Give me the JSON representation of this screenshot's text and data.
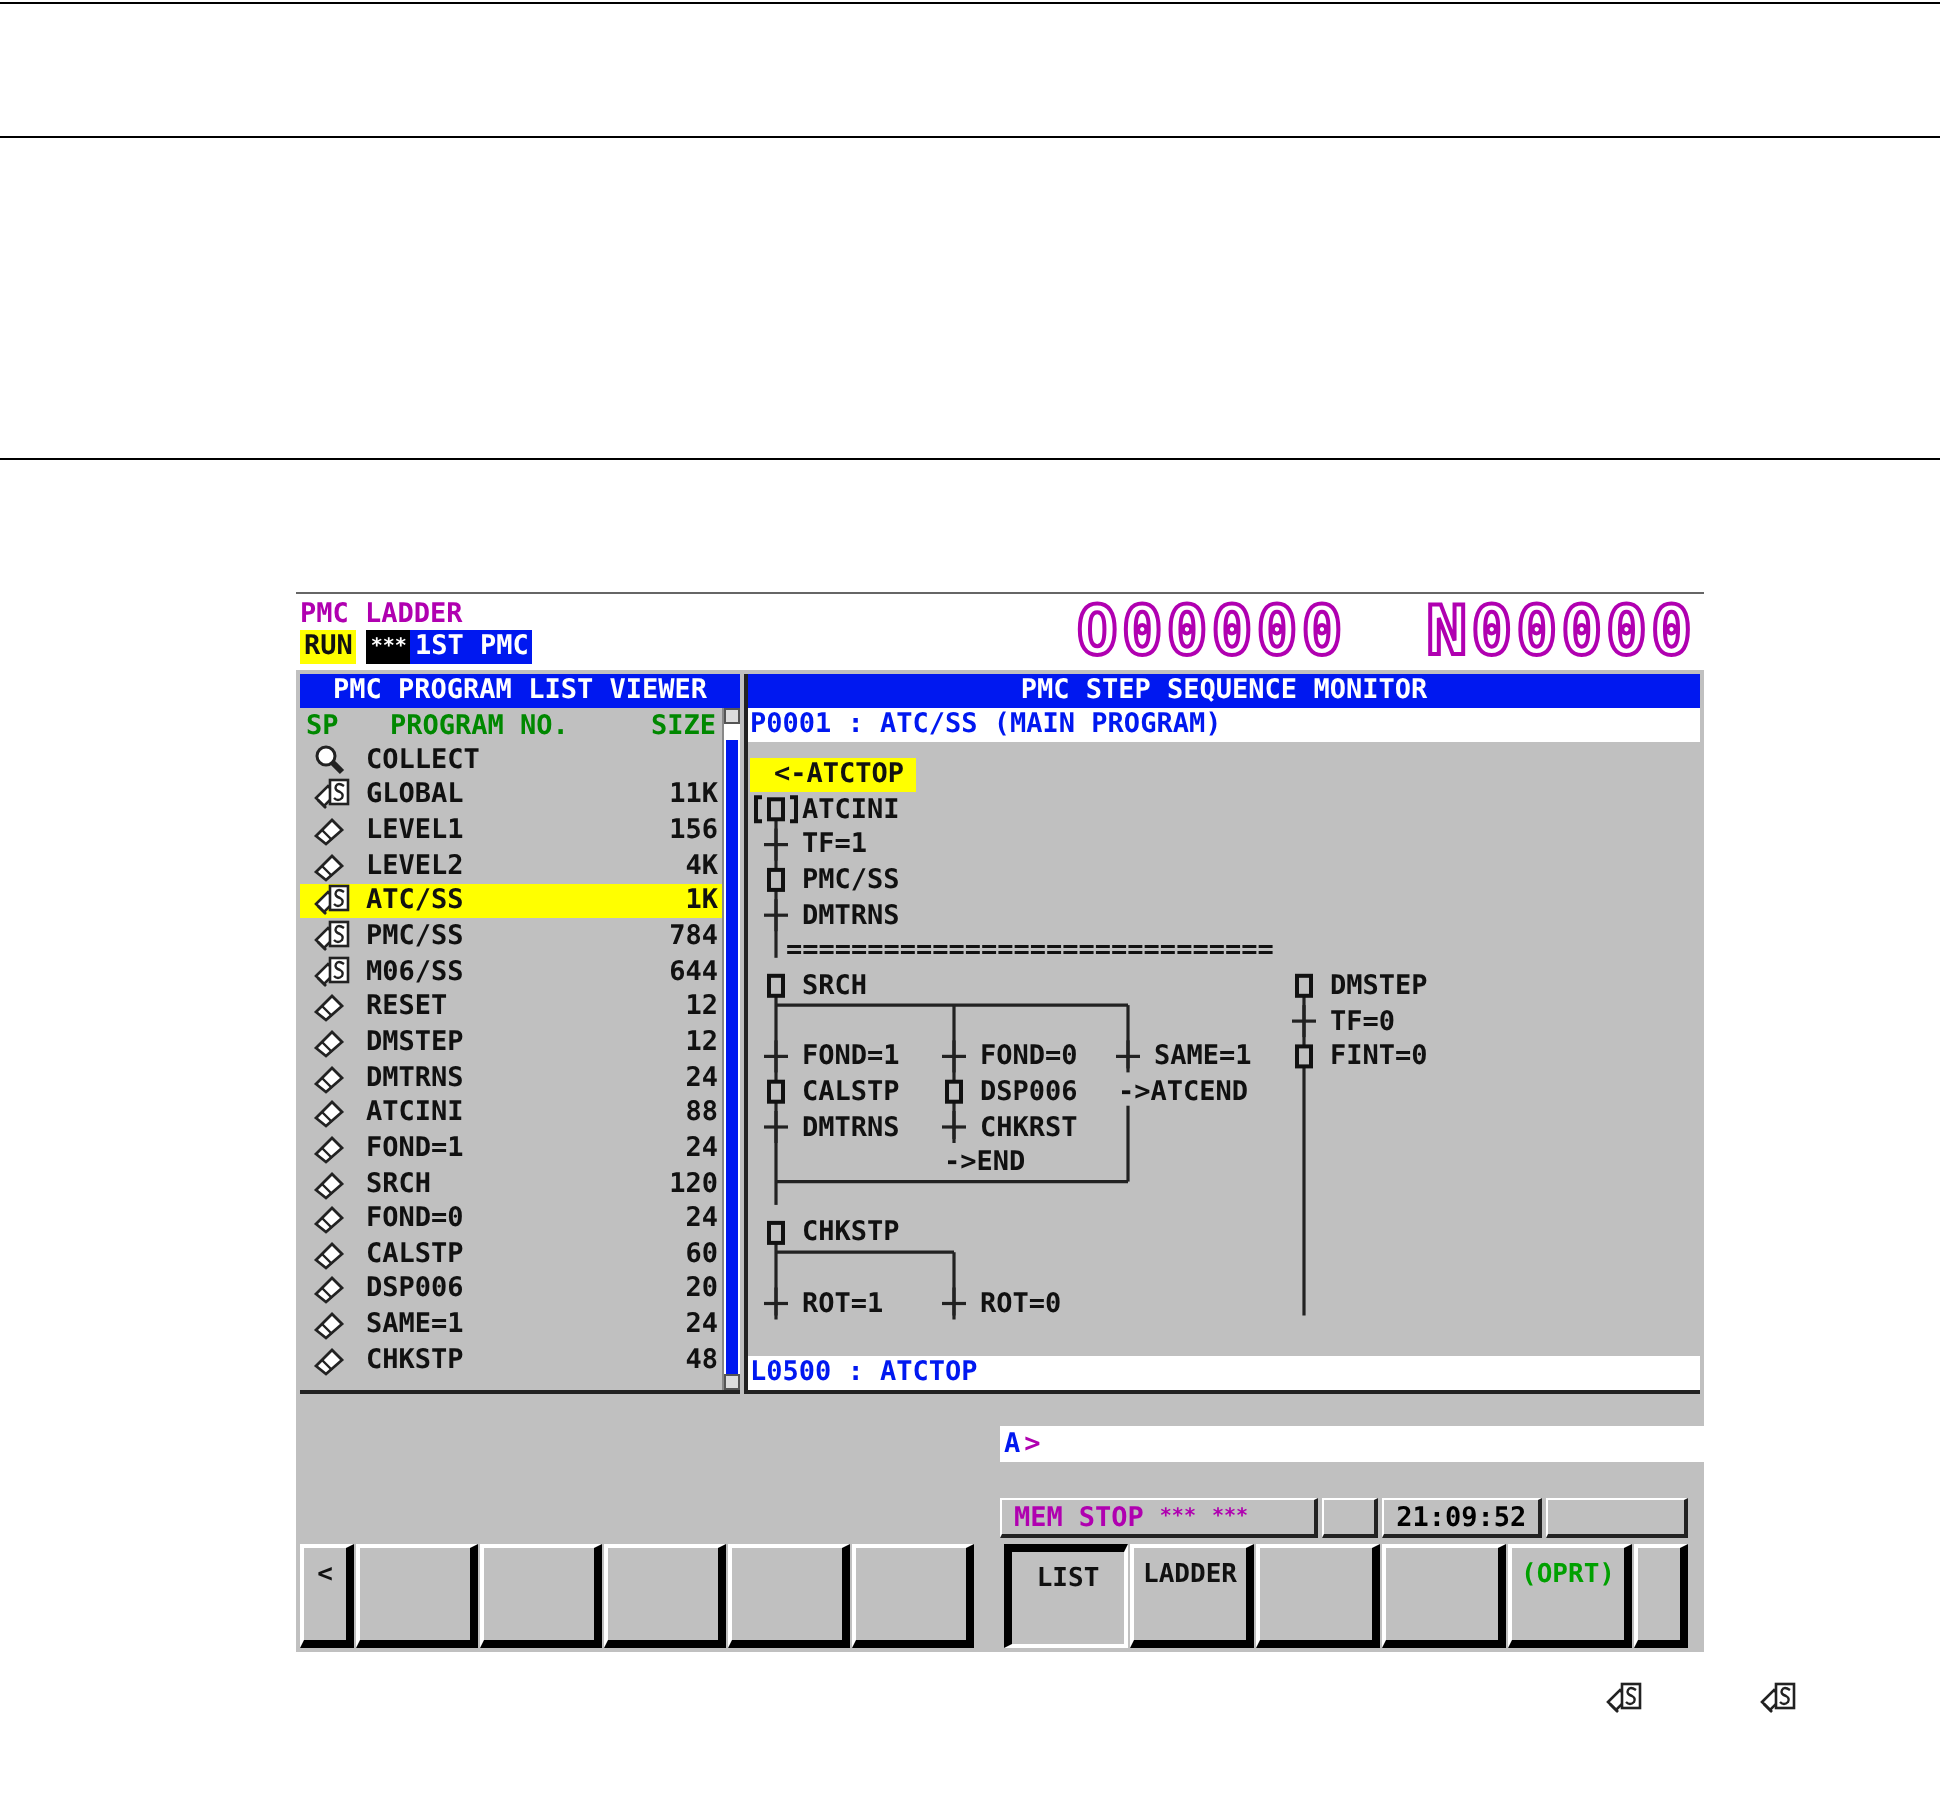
{
  "header": {
    "title": "PMC LADDER",
    "run_state": "RUN",
    "alarm": "***",
    "pmc": "1ST PMC",
    "program_number": "O00000",
    "sequence_number": "N00000"
  },
  "program_list": {
    "title": "PMC PROGRAM LIST VIEWER",
    "columns": [
      "SP",
      "PROGRAM NO.",
      "SIZE"
    ],
    "rows": [
      {
        "kind": "collect",
        "name": "COLLECT",
        "selected": false
      },
      {
        "kind": "sub",
        "name": "GLOBAL",
        "size": "11K",
        "selected": false
      },
      {
        "kind": "ladder",
        "name": "LEVEL1",
        "size": "156",
        "selected": false
      },
      {
        "kind": "ladder",
        "name": "LEVEL2",
        "size": "4K",
        "selected": false
      },
      {
        "kind": "sub",
        "name": "ATC/SS",
        "size": "1K",
        "selected": true
      },
      {
        "kind": "sub",
        "name": "PMC/SS",
        "size": "784",
        "selected": false
      },
      {
        "kind": "sub",
        "name": "M06/SS",
        "size": "644",
        "selected": false
      },
      {
        "kind": "ladder",
        "name": "RESET",
        "size": "12",
        "selected": false
      },
      {
        "kind": "ladder",
        "name": "DMSTEP",
        "size": "12",
        "selected": false
      },
      {
        "kind": "ladder",
        "name": "DMTRNS",
        "size": "24",
        "selected": false
      },
      {
        "kind": "ladder",
        "name": "ATCINI",
        "size": "88",
        "selected": false
      },
      {
        "kind": "ladder",
        "name": "FOND=1",
        "size": "24",
        "selected": false
      },
      {
        "kind": "ladder",
        "name": "SRCH",
        "size": "120",
        "selected": false
      },
      {
        "kind": "ladder",
        "name": "FOND=0",
        "size": "24",
        "selected": false
      },
      {
        "kind": "ladder",
        "name": "CALSTP",
        "size": "60",
        "selected": false
      },
      {
        "kind": "ladder",
        "name": "DSP006",
        "size": "20",
        "selected": false
      },
      {
        "kind": "ladder",
        "name": "SAME=1",
        "size": "24",
        "selected": false
      },
      {
        "kind": "ladder",
        "name": "CHKSTP",
        "size": "48",
        "selected": false
      }
    ]
  },
  "monitor": {
    "title": "PMC STEP SEQUENCE MONITOR",
    "program": "P0001 : ATC/SS (MAIN PROGRAM)",
    "items": [
      {
        "kind": "label",
        "text": "<-ATCTOP"
      },
      {
        "kind": "initial",
        "text": "ATCINI"
      },
      {
        "kind": "transition",
        "text": "TF=1"
      },
      {
        "kind": "step",
        "text": "PMC/SS"
      },
      {
        "kind": "transition",
        "text": "DMTRNS"
      },
      {
        "kind": "divider",
        "text": "=============================="
      },
      {
        "kind": "step",
        "text": "SRCH"
      },
      {
        "kind": "step",
        "text": "DMSTEP"
      },
      {
        "kind": "transition",
        "text": "TF=0"
      },
      {
        "kind": "transition",
        "text": "FOND=1"
      },
      {
        "kind": "transition",
        "text": "FOND=0"
      },
      {
        "kind": "transition",
        "text": "SAME=1"
      },
      {
        "kind": "step",
        "text": "FINT=0"
      },
      {
        "kind": "step",
        "text": "CALSTP"
      },
      {
        "kind": "step",
        "text": "DSP006"
      },
      {
        "kind": "jump",
        "text": "->ATCEND"
      },
      {
        "kind": "transition",
        "text": "DMTRNS"
      },
      {
        "kind": "transition",
        "text": "CHKRST"
      },
      {
        "kind": "jump",
        "text": "->END"
      },
      {
        "kind": "step",
        "text": "CHKSTP"
      },
      {
        "kind": "transition",
        "text": "ROT=1"
      },
      {
        "kind": "transition",
        "text": "ROT=0"
      }
    ],
    "footer": "L0500 : ATCTOP"
  },
  "input_line": {
    "prompt": "A",
    "cursor": ">"
  },
  "status_bar": {
    "mode": "MEM",
    "state": "STOP",
    "alarm_1": "***",
    "alarm_2": "***",
    "time": "21:09:52"
  },
  "soft_keys_left": [
    {
      "kind": "nav",
      "label": "<",
      "selected": false
    },
    {
      "kind": "blank",
      "selected": false
    },
    {
      "kind": "blank",
      "selected": false
    },
    {
      "kind": "blank",
      "selected": false
    },
    {
      "kind": "blank",
      "selected": false
    },
    {
      "kind": "blank",
      "selected": false
    }
  ],
  "soft_keys_right": [
    {
      "kind": "key",
      "label": "LIST",
      "selected": true
    },
    {
      "kind": "key",
      "label": "LADDER",
      "selected": false
    },
    {
      "kind": "blank",
      "selected": false
    },
    {
      "kind": "blank",
      "selected": false
    },
    {
      "kind": "operation",
      "label": "(OPRT)",
      "selected": false
    },
    {
      "kind": "nav",
      "selected": false
    }
  ]
}
